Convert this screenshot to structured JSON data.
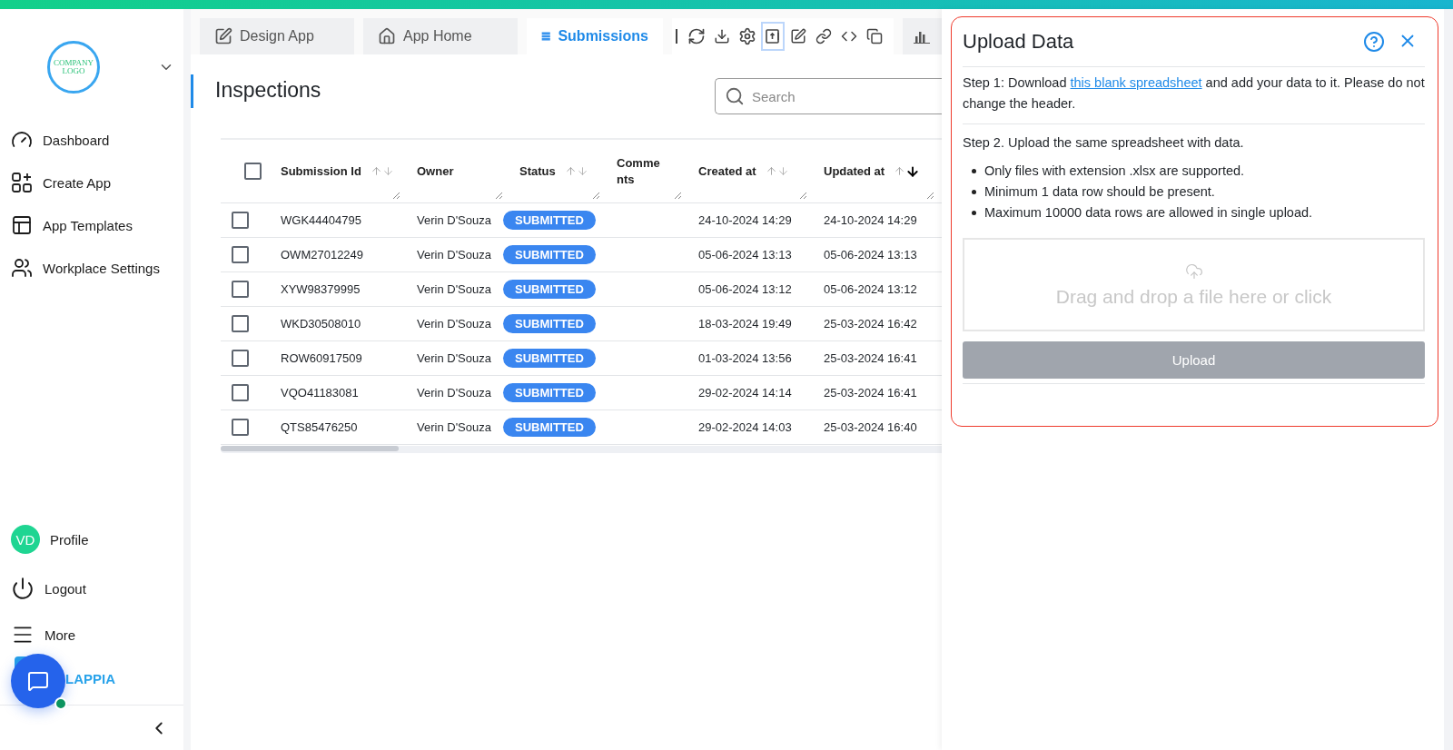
{
  "sidebar": {
    "logo_text": "COMPANY LOGO",
    "nav": [
      {
        "label": "Dashboard"
      },
      {
        "label": "Create App"
      },
      {
        "label": "App Templates"
      },
      {
        "label": "Workplace Settings"
      }
    ],
    "bottom": [
      {
        "label": "Profile",
        "kind": "avatar",
        "initials": "VD"
      },
      {
        "label": "Logout",
        "kind": "icon"
      },
      {
        "label": "More",
        "kind": "icon"
      }
    ],
    "brand": "LAPPIA"
  },
  "tabs": [
    {
      "label": "Design App",
      "selected": false
    },
    {
      "label": "App Home",
      "selected": false
    },
    {
      "label": "Submissions",
      "selected": true
    }
  ],
  "toolbar": [
    {
      "selected": false
    },
    {
      "selected": false
    },
    {
      "selected": false
    },
    {
      "selected": true
    },
    {
      "selected": false
    },
    {
      "selected": false
    },
    {
      "selected": false
    },
    {
      "selected": false
    }
  ],
  "page_title": "Inspections",
  "search": {
    "placeholder": "Search"
  },
  "table": {
    "columns": [
      {
        "label": "Submission Id",
        "sortable": true,
        "sort_desc": false
      },
      {
        "label": "Owner",
        "sortable": false
      },
      {
        "label": "Status",
        "sortable": true,
        "sort_desc": false
      },
      {
        "label": "Comments",
        "sortable": false
      },
      {
        "label": "Created at",
        "sortable": true,
        "sort_desc": false
      },
      {
        "label": "Updated at",
        "sortable": true,
        "sort_desc": true
      }
    ],
    "header_checked": false,
    "rows": [
      {
        "checked": false,
        "id": "WGK44404795",
        "owner": "Verin D'Souza",
        "status": "SUBMITTED",
        "created": "24-10-2024 14:29",
        "updated": "24-10-2024 14:29"
      },
      {
        "checked": false,
        "id": "OWM27012249",
        "owner": "Verin D'Souza",
        "status": "SUBMITTED",
        "created": "05-06-2024 13:13",
        "updated": "05-06-2024 13:13"
      },
      {
        "checked": false,
        "id": "XYW98379995",
        "owner": "Verin D'Souza",
        "status": "SUBMITTED",
        "created": "05-06-2024 13:12",
        "updated": "05-06-2024 13:12"
      },
      {
        "checked": false,
        "id": "WKD30508010",
        "owner": "Verin D'Souza",
        "status": "SUBMITTED",
        "created": "18-03-2024 19:49",
        "updated": "25-03-2024 16:42"
      },
      {
        "checked": false,
        "id": "ROW60917509",
        "owner": "Verin D'Souza",
        "status": "SUBMITTED",
        "created": "01-03-2024 13:56",
        "updated": "25-03-2024 16:41"
      },
      {
        "checked": false,
        "id": "VQO41183081",
        "owner": "Verin D'Souza",
        "status": "SUBMITTED",
        "created": "29-02-2024 14:14",
        "updated": "25-03-2024 16:41"
      },
      {
        "checked": false,
        "id": "QTS85476250",
        "owner": "Verin D'Souza",
        "status": "SUBMITTED",
        "created": "29-02-2024 14:03",
        "updated": "25-03-2024 16:40"
      }
    ]
  },
  "upload_panel": {
    "title": "Upload Data",
    "step1_before": "Step 1: Download ",
    "step1_link": "this blank spreadsheet",
    "step1_after": " and add your data to it. Please do not change the header.",
    "step2": "Step 2. Upload the same spreadsheet with data.",
    "rules": [
      "Only files with extension .xlsx are supported.",
      "Minimum 1 data row should be present.",
      "Maximum 10000 data rows are allowed in single upload."
    ],
    "dropzone": {
      "placeholder": "Drag and drop a file here or click"
    },
    "upload_button": {
      "label": "Upload",
      "disabled": true
    }
  }
}
